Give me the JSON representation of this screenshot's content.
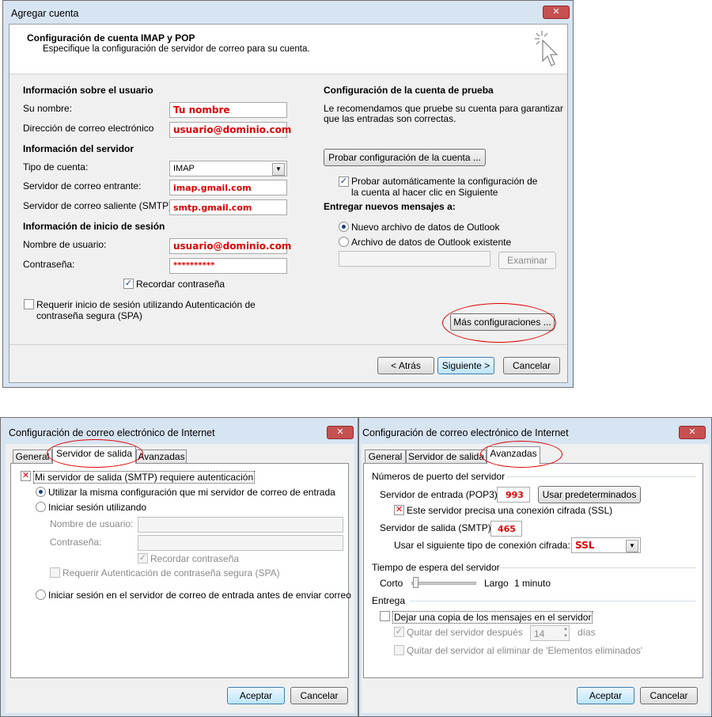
{
  "dialog1": {
    "title": "Agregar cuenta",
    "close": "✕",
    "header_title": "Configuración de cuenta IMAP y POP",
    "header_subtitle": "Especifique la configuración de servidor de correo para su cuenta.",
    "user_info_heading": "Información sobre el usuario",
    "name_label": "Su nombre:",
    "name_value": "Tu nombre",
    "email_label": "Dirección de correo electrónico",
    "email_value": "usuario@dominio.com",
    "server_info_heading": "Información del servidor",
    "account_type_label": "Tipo de cuenta:",
    "account_type_value": "IMAP",
    "incoming_label": "Servidor de correo entrante:",
    "incoming_value": "imap.gmail.com",
    "outgoing_label": "Servidor de correo saliente (SMTP):",
    "outgoing_value": "smtp.gmail.com",
    "login_heading": "Información de inicio de sesión",
    "username_label": "Nombre de usuario:",
    "username_value": "usuario@dominio.com",
    "password_label": "Contraseña:",
    "password_value": "**********",
    "remember_password": "Recordar contraseña",
    "spa_line1": "Requerir inicio de sesión utilizando Autenticación de",
    "spa_line2": "contraseña segura (SPA)",
    "test_heading": "Configuración de la cuenta de prueba",
    "test_desc1": "Le recomendamos que pruebe su cuenta para garantizar",
    "test_desc2": "que las entradas son correctas.",
    "test_button": "Probar configuración de la cuenta ...",
    "auto_test1": "Probar automáticamente la configuración de",
    "auto_test2": "la cuenta al hacer clic en Siguiente",
    "deliver_heading": "Entregar nuevos mensajes a:",
    "new_data_file": "Nuevo archivo de datos de Outlook",
    "existing_data_file": "Archivo de datos de Outlook existente",
    "browse_button": "Examinar",
    "more_settings": "Más configuraciones ...",
    "back_button": "< Atrás",
    "next_button": "Siguiente >",
    "cancel_button": "Cancelar"
  },
  "dialog2": {
    "title": "Configuración de correo electrónico de Internet",
    "close": "✕",
    "tabs": [
      "General",
      "Servidor de salida",
      "Avanzadas"
    ],
    "smtp_auth": "Mi servidor de salida (SMTP) requiere autenticación",
    "same_settings": "Utilizar la misma configuración que mi servidor de correo de entrada",
    "login_using": "Iniciar sesión utilizando",
    "username_label": "Nombre de usuario:",
    "password_label": "Contraseña:",
    "remember_password": "Recordar contraseña",
    "require_spa": "Requerir Autenticación de contraseña segura (SPA)",
    "login_before": "Iniciar sesión en el servidor de correo de entrada antes de enviar correo",
    "ok_button": "Aceptar",
    "cancel_button": "Cancelar"
  },
  "dialog3": {
    "title": "Configuración de correo electrónico de Internet",
    "close": "✕",
    "tabs": [
      "General",
      "Servidor de salida",
      "Avanzadas"
    ],
    "ports_heading": "Números de puerto del servidor",
    "incoming_label": "Servidor de entrada (POP3):",
    "incoming_port": "993",
    "defaults_button": "Usar predeterminados",
    "ssl_required": "Este servidor precisa una conexión cifrada (SSL)",
    "outgoing_label": "Servidor de salida (SMTP):",
    "outgoing_port": "465",
    "encryption_label": "Usar el siguiente tipo de conexión cifrada:",
    "encryption_value": "SSL",
    "timeout_heading": "Tiempo de espera del servidor",
    "short_label": "Corto",
    "long_label": "Largo",
    "timeout_value": "1 minuto",
    "delivery_heading": "Entrega",
    "leave_copy": "Dejar una copia de los mensajes en el servidor",
    "remove_after": "Quitar del servidor después",
    "days_value": "14",
    "days_label": "días",
    "remove_deleted": "Quitar del servidor al eliminar de 'Elementos eliminados'",
    "ok_button": "Aceptar",
    "cancel_button": "Cancelar"
  }
}
